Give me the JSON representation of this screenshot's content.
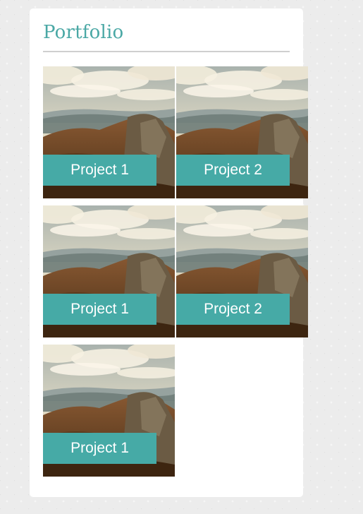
{
  "portfolio": {
    "title": "Portfolio",
    "tiles": [
      {
        "label": "Project 1"
      },
      {
        "label": "Project 2"
      },
      {
        "label": "Project 1"
      },
      {
        "label": "Project 2"
      },
      {
        "label": "Project 1"
      }
    ]
  },
  "colors": {
    "accent": "#46aaa6",
    "title": "#4aa8a5",
    "divider": "#cfcfcf"
  },
  "icons": {
    "tile_image": "mountain-landscape-photo"
  }
}
